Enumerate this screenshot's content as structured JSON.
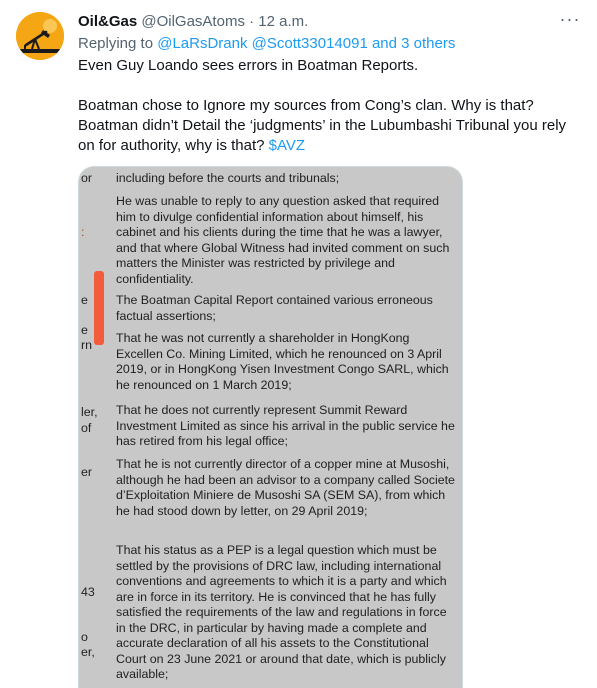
{
  "tweet": {
    "display_name": "Oil&Gas",
    "handle": "@OilGasAtoms",
    "separator": "·",
    "time": "12 a.m.",
    "more_icon": "more-horizontal-icon",
    "reply_prefix": "Replying to ",
    "reply_targets": "@LaRsDrank @Scott33014091 and 3 others",
    "line1": "Even Guy Loando sees errors in Boatman Reports.",
    "line2": "Boatman chose to Ignore my sources from Cong’s clan. Why is that? Boatman didn’t Detail the ‘judgments’ in the Lubumbashi Tribunal you rely on for authority, why is that?",
    "cashtag": "$AVZ"
  },
  "document": {
    "left_fragments": [
      "or",
      ":",
      "e",
      "e",
      "rn",
      "ler,",
      "of",
      "er",
      "43",
      "o",
      "er,"
    ],
    "paragraphs": [
      "including before the courts and tribunals;",
      "He was unable to reply to any question asked that required him to divulge confidential information about himself, his cabinet and his clients during the time that he was a lawyer, and that where Global Witness had invited comment on such matters the Minister was restricted by privilege and confidentiality.",
      "The Boatman Capital Report contained various erroneous factual assertions;",
      "That he was not currently a shareholder in HongKong Excellen Co. Mining Limited, which he renounced on 3 April 2019, or in HongKong Yisen Investment Congo SARL, which he renounced on 1 March 2019;",
      "That he does not currently represent Summit Reward Investment Limited as since his arrival in the public service he has retired from his legal office;",
      "That he is not currently director of a copper mine at Musoshi, although he had been an advisor to a company called Societe d’Exploitation Miniere de Musoshi SA (SEM SA), from which he had stood down by letter, on 29 April 2019;",
      "That his status as a PEP is a legal question which must be settled by the provisions of DRC law, including international conventions and agreements to which it is a party and which are in force in its territory. He is convinced that he has fully satisfied the requirements of the law and regulations in force in the DRC, in particular by having made a complete and accurate declaration of all his assets to the Constitutional Court on 23 June 2021 or around that date, which is publicly available;"
    ]
  }
}
